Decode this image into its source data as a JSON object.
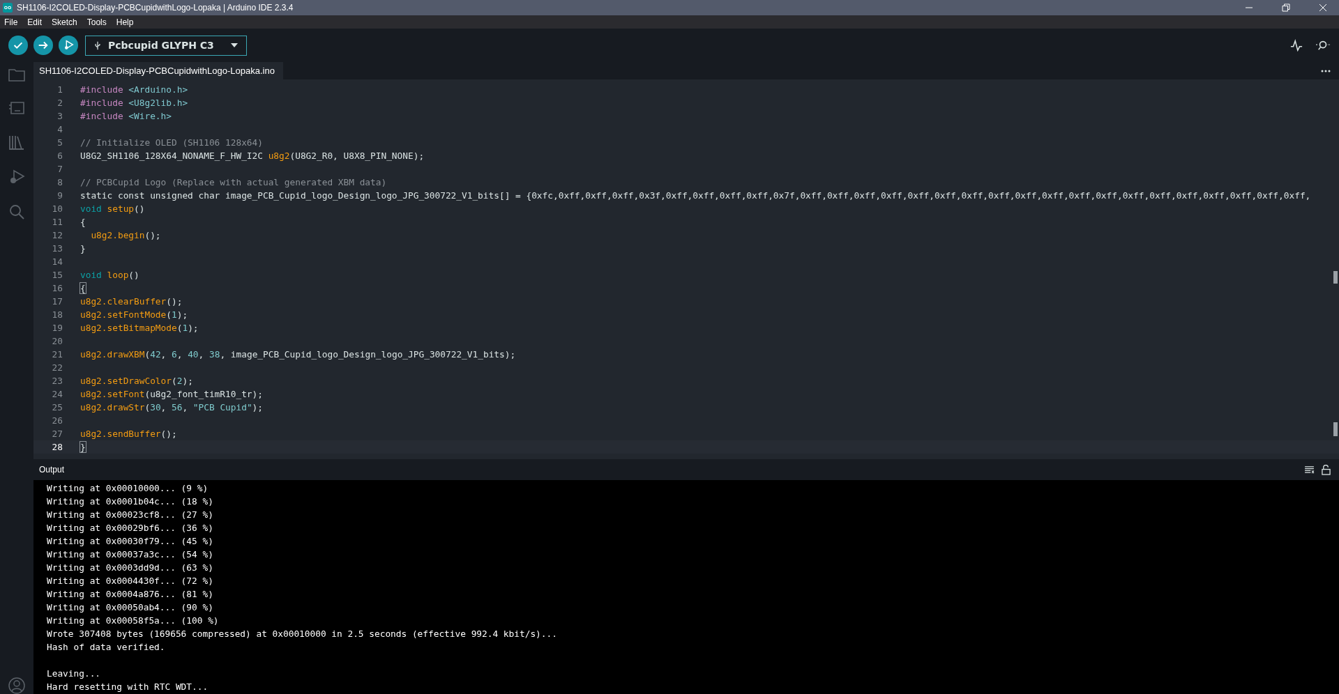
{
  "window": {
    "title": "SH1106-I2COLED-Display-PCBCupidwithLogo-Lopaka | Arduino IDE 2.3.4"
  },
  "menu": [
    "File",
    "Edit",
    "Sketch",
    "Tools",
    "Help"
  ],
  "toolbar": {
    "board": "Pcbcupid GLYPH C3"
  },
  "editor": {
    "tab": {
      "label": "SH1106-I2COLED-Display-PCBCupidwithLogo-Lopaka.ino",
      "selected": true
    },
    "lines": [
      {
        "number": "1",
        "current": false,
        "tokens": [
          {
            "kind": "preproc",
            "text": "#include "
          },
          {
            "kind": "path",
            "text": "<Arduino.h>"
          }
        ]
      },
      {
        "number": "2",
        "current": false,
        "tokens": [
          {
            "kind": "preproc",
            "text": "#include "
          },
          {
            "kind": "path",
            "text": "<U8g2lib.h>"
          }
        ]
      },
      {
        "number": "3",
        "current": false,
        "tokens": [
          {
            "kind": "preproc",
            "text": "#include "
          },
          {
            "kind": "path",
            "text": "<Wire.h>"
          }
        ]
      },
      {
        "number": "4",
        "current": false
      },
      {
        "number": "5",
        "current": false,
        "tokens": [
          {
            "kind": "comment",
            "text": "// Initialize OLED (SH1106 128x64)"
          }
        ]
      },
      {
        "number": "6",
        "current": false,
        "tokens": [
          {
            "kind": "plain",
            "text": "U8G2_SH1106_128X64_NONAME_F_HW_I2C "
          },
          {
            "kind": "func",
            "text": "u8g2"
          },
          {
            "kind": "plain",
            "text": "(U8G2_R0, U8X8_PIN_NONE);"
          }
        ]
      },
      {
        "number": "7",
        "current": false
      },
      {
        "number": "8",
        "current": false,
        "tokens": [
          {
            "kind": "comment",
            "text": "// PCBCupid Logo (Replace with actual generated XBM data)"
          }
        ]
      },
      {
        "number": "9",
        "current": false,
        "tokens": [
          {
            "kind": "plain",
            "text": "static const unsigned char image_PCB_Cupid_logo_Design_logo_JPG_300722_V1_bits[] = {0xfc,0xff,0xff,0xff,0x3f,0xff,0xff,0xff,0xff,0x7f,0xff,0xff,0xff,0xff,0xff,0xff,0xff,0xff,0xff,0xff,0xff,0xff,0xff,0xff,0xff,0xff,0xff,0xff,0xff,"
          }
        ]
      },
      {
        "number": "10",
        "current": false,
        "tokens": [
          {
            "kind": "keyword",
            "text": "void "
          },
          {
            "kind": "func",
            "text": "setup"
          },
          {
            "kind": "plain",
            "text": "()"
          }
        ]
      },
      {
        "number": "11",
        "current": false,
        "tokens": [
          {
            "kind": "plain",
            "text": "{"
          }
        ]
      },
      {
        "number": "12",
        "current": false,
        "tokens": [
          {
            "kind": "func",
            "text": "  u8g2.begin"
          },
          {
            "kind": "plain",
            "text": "();"
          }
        ]
      },
      {
        "number": "13",
        "current": false,
        "tokens": [
          {
            "kind": "plain",
            "text": "}"
          }
        ]
      },
      {
        "number": "14",
        "current": false
      },
      {
        "number": "15",
        "current": false,
        "tokens": [
          {
            "kind": "keyword",
            "text": "void "
          },
          {
            "kind": "func",
            "text": "loop"
          },
          {
            "kind": "plain",
            "text": "()"
          }
        ]
      },
      {
        "number": "16",
        "current": false,
        "tokens": [
          {
            "kind": "bracket",
            "text": "{"
          }
        ]
      },
      {
        "number": "17",
        "current": false,
        "tokens": [
          {
            "kind": "func",
            "text": "u8g2.clearBuffer"
          },
          {
            "kind": "plain",
            "text": "();"
          }
        ]
      },
      {
        "number": "18",
        "current": false,
        "tokens": [
          {
            "kind": "func",
            "text": "u8g2.setFontMode"
          },
          {
            "kind": "plain",
            "text": "("
          },
          {
            "kind": "number",
            "text": "1"
          },
          {
            "kind": "plain",
            "text": ");"
          }
        ]
      },
      {
        "number": "19",
        "current": false,
        "tokens": [
          {
            "kind": "func",
            "text": "u8g2.setBitmapMode"
          },
          {
            "kind": "plain",
            "text": "("
          },
          {
            "kind": "number",
            "text": "1"
          },
          {
            "kind": "plain",
            "text": ");"
          }
        ]
      },
      {
        "number": "20",
        "current": false
      },
      {
        "number": "21",
        "current": false,
        "tokens": [
          {
            "kind": "func",
            "text": "u8g2.drawXBM"
          },
          {
            "kind": "plain",
            "text": "("
          },
          {
            "kind": "number",
            "text": "42"
          },
          {
            "kind": "plain",
            "text": ", "
          },
          {
            "kind": "number",
            "text": "6"
          },
          {
            "kind": "plain",
            "text": ", "
          },
          {
            "kind": "number",
            "text": "40"
          },
          {
            "kind": "plain",
            "text": ", "
          },
          {
            "kind": "number",
            "text": "38"
          },
          {
            "kind": "plain",
            "text": ", image_PCB_Cupid_logo_Design_logo_JPG_300722_V1_bits);"
          }
        ]
      },
      {
        "number": "22",
        "current": false
      },
      {
        "number": "23",
        "current": false,
        "tokens": [
          {
            "kind": "func",
            "text": "u8g2.setDrawColor"
          },
          {
            "kind": "plain",
            "text": "("
          },
          {
            "kind": "number",
            "text": "2"
          },
          {
            "kind": "plain",
            "text": ");"
          }
        ]
      },
      {
        "number": "24",
        "current": false,
        "tokens": [
          {
            "kind": "func",
            "text": "u8g2.setFont"
          },
          {
            "kind": "plain",
            "text": "(u8g2_font_timR10_tr);"
          }
        ]
      },
      {
        "number": "25",
        "current": false,
        "tokens": [
          {
            "kind": "func",
            "text": "u8g2.drawStr"
          },
          {
            "kind": "plain",
            "text": "("
          },
          {
            "kind": "number",
            "text": "30"
          },
          {
            "kind": "plain",
            "text": ", "
          },
          {
            "kind": "number",
            "text": "56"
          },
          {
            "kind": "plain",
            "text": ", "
          },
          {
            "kind": "string",
            "text": "\"PCB Cupid\""
          },
          {
            "kind": "plain",
            "text": ");"
          }
        ]
      },
      {
        "number": "26",
        "current": false
      },
      {
        "number": "27",
        "current": false,
        "tokens": [
          {
            "kind": "func",
            "text": "u8g2.sendBuffer"
          },
          {
            "kind": "plain",
            "text": "();"
          }
        ]
      },
      {
        "number": "28",
        "current": true,
        "tokens": [
          {
            "kind": "bracket",
            "text": "}"
          }
        ]
      }
    ]
  },
  "output": {
    "title": "Output",
    "blocks": [
      [
        "Writing at 0x00010000... (9 %)",
        "Writing at 0x0001b04c... (18 %)",
        "Writing at 0x00023cf8... (27 %)",
        "Writing at 0x00029bf6... (36 %)",
        "Writing at 0x00030f79... (45 %)",
        "Writing at 0x00037a3c... (54 %)",
        "Writing at 0x0003dd9d... (63 %)",
        "Writing at 0x0004430f... (72 %)",
        "Writing at 0x0004a876... (81 %)",
        "Writing at 0x00050ab4... (90 %)",
        "Writing at 0x00058f5a... (100 %)",
        "Wrote 307408 bytes (169656 compressed) at 0x00010000 in 2.5 seconds (effective 992.4 kbit/s)...",
        "Hash of data verified."
      ],
      [
        "Leaving...",
        "Hard resetting with RTC WDT..."
      ]
    ]
  }
}
